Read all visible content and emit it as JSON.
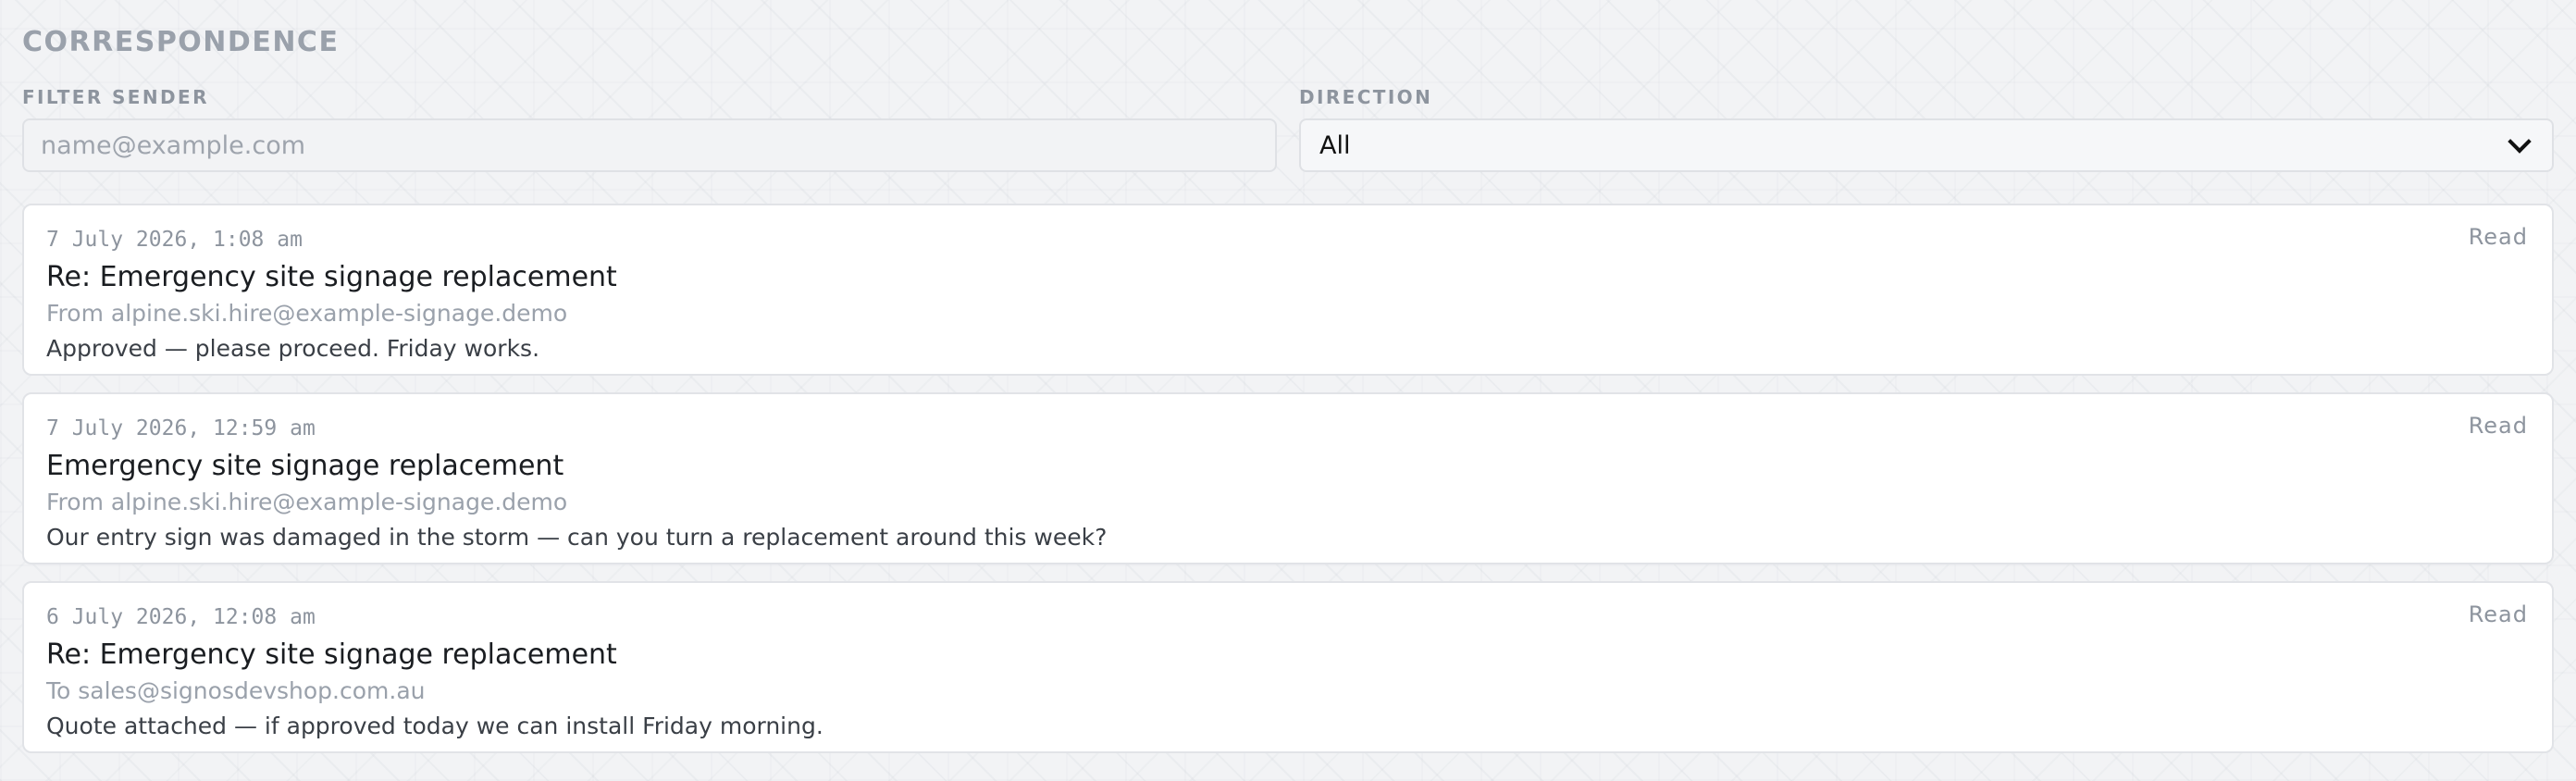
{
  "page": {
    "title": "CORRESPONDENCE"
  },
  "filters": {
    "sender_label": "FILTER SENDER",
    "sender_placeholder": "name@example.com",
    "sender_value": "",
    "direction_label": "DIRECTION",
    "direction_value": "All"
  },
  "messages": [
    {
      "date": "7 July 2026, 1:08 am",
      "status": "Read",
      "subject": "Re: Emergency site signage replacement",
      "party": "From alpine.ski.hire@example-signage.demo",
      "snippet": "Approved — please proceed. Friday works."
    },
    {
      "date": "7 July 2026, 12:59 am",
      "status": "Read",
      "subject": "Emergency site signage replacement",
      "party": "From alpine.ski.hire@example-signage.demo",
      "snippet": "Our entry sign was damaged in the storm — can you turn a replacement around this week?"
    },
    {
      "date": "6 July 2026, 12:08 am",
      "status": "Read",
      "subject": "Re: Emergency site signage replacement",
      "party": "To sales@signosdevshop.com.au",
      "snippet": "Quote attached — if approved today we can install Friday morning."
    }
  ]
}
